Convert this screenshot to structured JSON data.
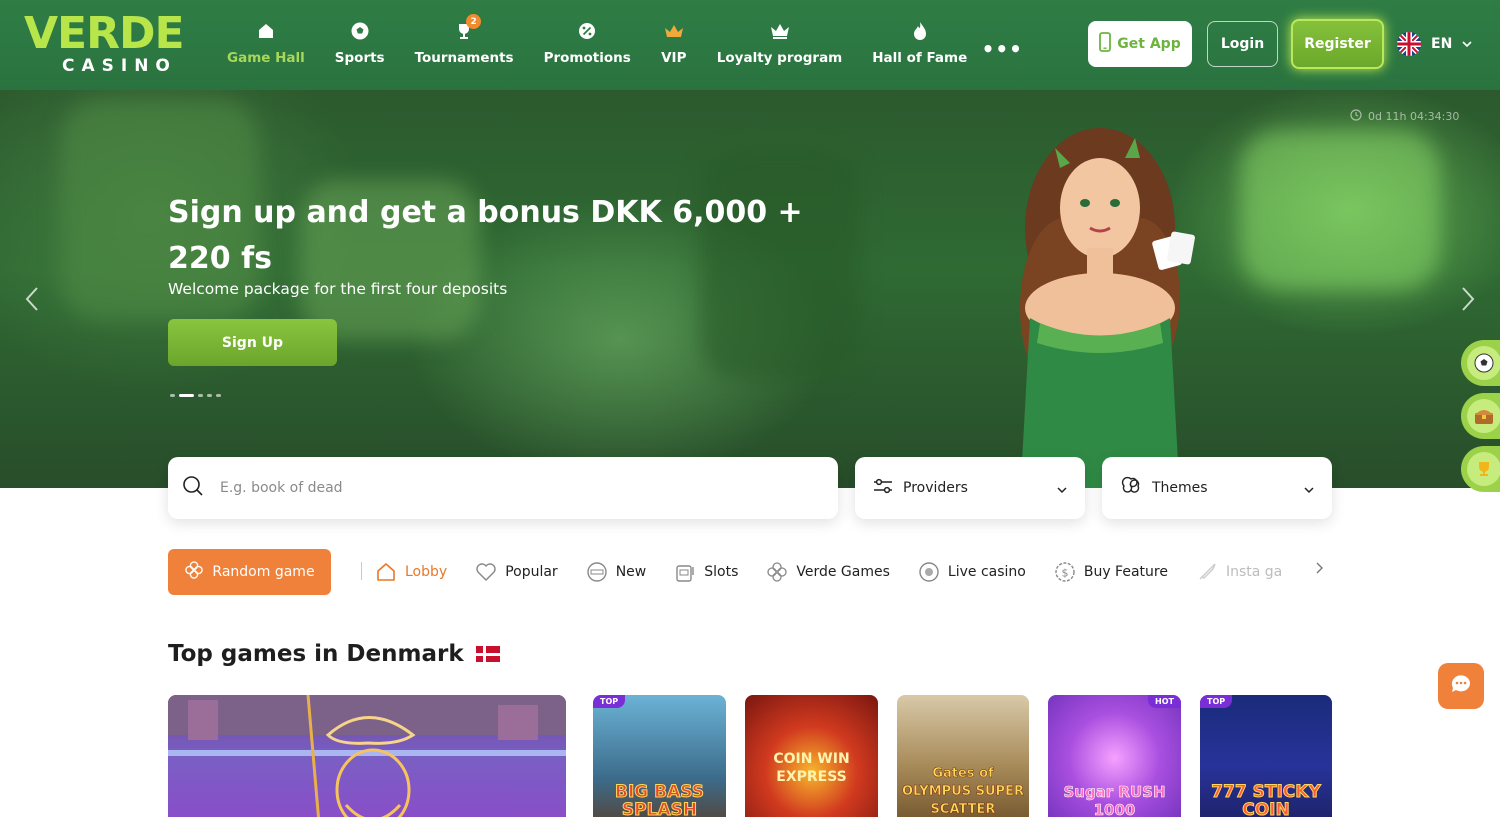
{
  "header": {
    "logo_top": "VERDE",
    "logo_bottom": "CASINO",
    "nav": [
      {
        "label": "Game Hall",
        "icon": "home-icon",
        "active": true
      },
      {
        "label": "Sports",
        "icon": "soccer-ball-icon"
      },
      {
        "label": "Tournaments",
        "icon": "trophy-icon",
        "badge": "2"
      },
      {
        "label": "Promotions",
        "icon": "percent-badge-icon"
      },
      {
        "label": "VIP",
        "icon": "crown-icon"
      },
      {
        "label": "Loyalty program",
        "icon": "crown-outline-icon"
      },
      {
        "label": "Hall of Fame",
        "icon": "flame-icon"
      }
    ],
    "more": "•••",
    "get_app": "Get App",
    "login": "Login",
    "register": "Register",
    "language": "EN"
  },
  "hero": {
    "title": "Sign up and get a bonus DKK 6,000 + 220 fs",
    "subtitle": "Welcome package for the first four deposits",
    "cta": "Sign Up",
    "timer": "0d 11h 04:34:30",
    "slides": 5,
    "active_slide": 2
  },
  "search": {
    "placeholder": "E.g. book of dead",
    "providers": "Providers",
    "themes": "Themes"
  },
  "categories": {
    "random": "Random game",
    "items": [
      {
        "label": "Lobby",
        "icon": "house-icon",
        "active": true
      },
      {
        "label": "Popular",
        "icon": "heart-icon"
      },
      {
        "label": "New",
        "icon": "new-badge-icon"
      },
      {
        "label": "Slots",
        "icon": "slot-machine-icon"
      },
      {
        "label": "Verde Games",
        "icon": "clover-icon"
      },
      {
        "label": "Live casino",
        "icon": "live-icon"
      },
      {
        "label": "Buy Feature",
        "icon": "dollar-coin-icon"
      },
      {
        "label": "Insta ga",
        "icon": "rocket-icon"
      }
    ]
  },
  "section": {
    "title": "Top games in Denmark"
  },
  "games": [
    {
      "name": "",
      "badge": ""
    },
    {
      "name": "BIG BASS SPLASH",
      "badge": "TOP"
    },
    {
      "name": "COIN WIN EXPRESS",
      "badge": ""
    },
    {
      "name": "Gates of OLYMPUS SUPER SCATTER",
      "badge": ""
    },
    {
      "name": "Sugar RUSH 1000",
      "badge": "HOT"
    },
    {
      "name": "777 STICKY COIN",
      "badge": "TOP"
    }
  ],
  "colors": {
    "header_green": "#2f7d45",
    "accent_lime": "#8ac53f",
    "accent_orange": "#f0813a"
  }
}
